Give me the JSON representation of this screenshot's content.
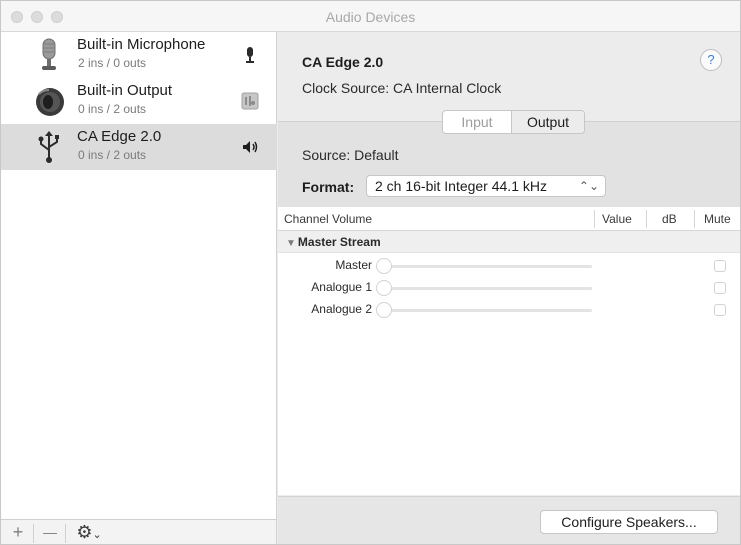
{
  "window": {
    "title": "Audio Devices"
  },
  "sidebar": {
    "devices": [
      {
        "name": "Built-in Microphone",
        "io": "2 ins / 0 outs",
        "icon": "microphone-icon",
        "status_icon": "microphone-icon",
        "selected": false
      },
      {
        "name": "Built-in Output",
        "io": "0 ins / 2 outs",
        "icon": "speaker-icon",
        "status_icon": "finder-icon",
        "selected": false
      },
      {
        "name": "CA Edge 2.0",
        "io": "0 ins / 2 outs",
        "icon": "usb-icon",
        "status_icon": "volume-icon",
        "selected": true
      }
    ],
    "bottom": {
      "add": "+",
      "remove": "—",
      "gear": "⚙",
      "gear_caret": "⌄"
    }
  },
  "detail": {
    "device_name": "CA Edge 2.0",
    "clock_source_label": "Clock Source:",
    "clock_source_value": "CA Internal Clock",
    "help": "?",
    "tabs": {
      "input": "Input",
      "output": "Output",
      "selected": "output"
    },
    "source_label": "Source:",
    "source_value": "Default",
    "format_label": "Format:",
    "format_value": "2 ch 16-bit Integer 44.1 kHz",
    "format_arrows": "⌃⌄"
  },
  "table": {
    "columns": {
      "channel": "Channel Volume",
      "value": "Value",
      "db": "dB",
      "mute": "Mute"
    },
    "group": "Master Stream",
    "group_tri": "▼",
    "rows": [
      {
        "label": "Master",
        "level": 0,
        "mute": false
      },
      {
        "label": "Analogue 1",
        "level": 0,
        "mute": false
      },
      {
        "label": "Analogue 2",
        "level": 0,
        "mute": false
      }
    ]
  },
  "footer": {
    "configure_speakers": "Configure Speakers..."
  },
  "colors": {
    "accent": "#3b7ed8",
    "selected_row": "#dcdcdc"
  }
}
